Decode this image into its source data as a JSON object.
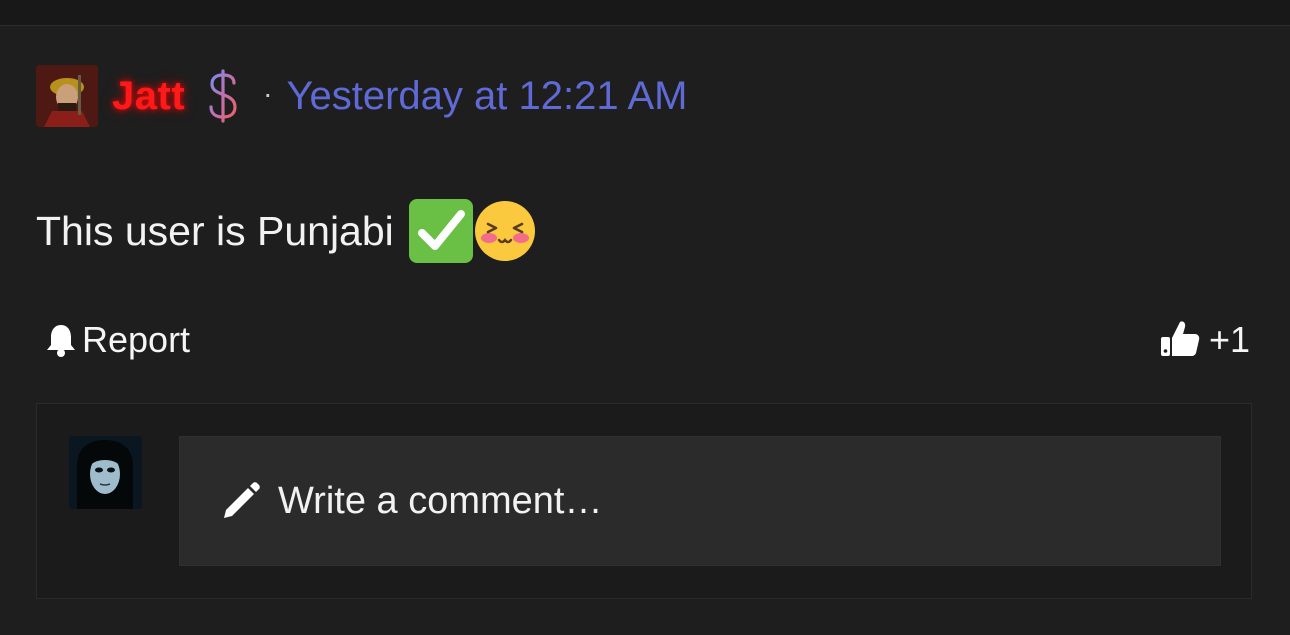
{
  "post": {
    "author": "Jatt",
    "separator": "·",
    "timestamp": "Yesterday at 12:21 AM",
    "body_text": "This user is Punjabi",
    "author_badge_icon": "dollar-sign-icon",
    "emojis": [
      "check-mark-button-emoji",
      "blushing-face-emoji"
    ]
  },
  "actions": {
    "report_label": "Report",
    "like_label": "+1"
  },
  "comment": {
    "placeholder": "Write a comment…"
  },
  "colors": {
    "background": "#1e1e1e",
    "author_name": "#ff1a1a",
    "timestamp": "#5f6ad6",
    "comment_input_bg": "#2b2b2b"
  }
}
